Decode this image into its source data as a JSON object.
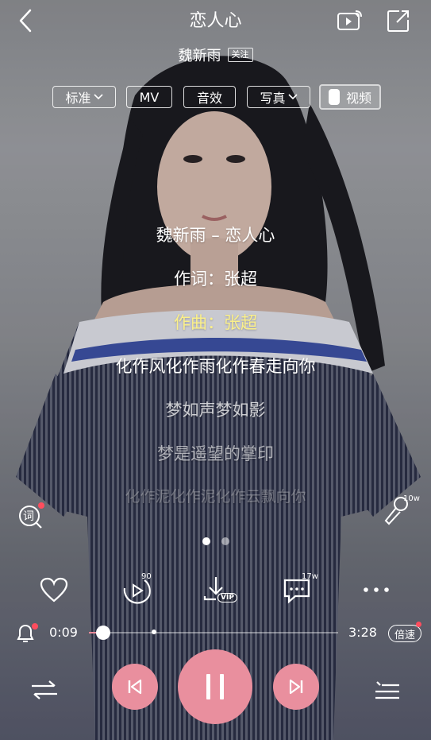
{
  "header": {
    "title": "恋人心",
    "artist": "魏新雨",
    "follow_label": "关注"
  },
  "modes": [
    {
      "label": "标准",
      "has_dropdown": true
    },
    {
      "label": "MV",
      "has_dropdown": false
    },
    {
      "label": "音效",
      "has_dropdown": false
    },
    {
      "label": "写真",
      "has_dropdown": true
    },
    {
      "label": "视频",
      "has_dropdown": false,
      "toggle": true
    }
  ],
  "lyrics": [
    {
      "text": "魏新雨 – 恋人心"
    },
    {
      "text": "作词：张超"
    },
    {
      "text": "作曲：张超",
      "current": true
    },
    {
      "text": "化作风化作雨化作春走向你"
    },
    {
      "text": "梦如声梦如影"
    },
    {
      "text": "梦是遥望的掌印"
    },
    {
      "text": "化作泥化作泥化作云飘向你"
    }
  ],
  "side": {
    "lyrics_badge": "词",
    "mic_count": "10w"
  },
  "actions": {
    "play_count": "90",
    "download_badge": "VIP",
    "comment_count": "17w"
  },
  "progress": {
    "current_time": "0:09",
    "total_time": "3:28",
    "fraction": 0.043,
    "speed_label": "倍速"
  },
  "pager": {
    "current": 1,
    "total": 2
  },
  "colors": {
    "accent": "#e98f9e",
    "current_lyric": "#fbf08a",
    "badge_red": "#ff4d5e"
  },
  "icons": [
    "back-icon",
    "share-video-icon",
    "external-share-icon",
    "heart-icon",
    "play-video-icon",
    "download-icon",
    "comment-icon",
    "more-icon",
    "alarm-bell-icon",
    "shuffle-icon",
    "previous-icon",
    "pause-icon",
    "next-icon",
    "playlist-icon",
    "microphone-icon",
    "lyric-search-icon"
  ]
}
